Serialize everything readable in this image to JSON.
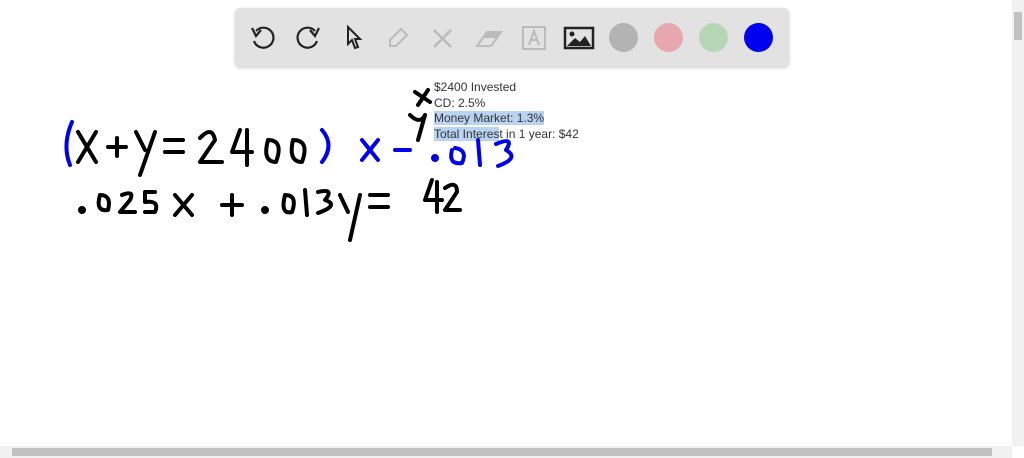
{
  "toolbar": {
    "tools": [
      "undo-icon",
      "redo-icon",
      "select-icon",
      "pen-icon",
      "tools-icon",
      "eraser-icon",
      "text-icon",
      "image-icon"
    ],
    "colors": [
      "#b3b3b3",
      "#e6a8ae",
      "#b6d7b5",
      "#0000ee"
    ]
  },
  "note": {
    "lines": [
      "$2400 Invested",
      "CD: 2.5%",
      "Money Market: 1.3%"
    ],
    "line4_highlighted": "Total Interes",
    "line4_rest": "t in 1 year: $42"
  },
  "handwriting": {
    "eq1": "(x+y=2400) x -.013",
    "eq2": ".025x + .013y = 42"
  }
}
